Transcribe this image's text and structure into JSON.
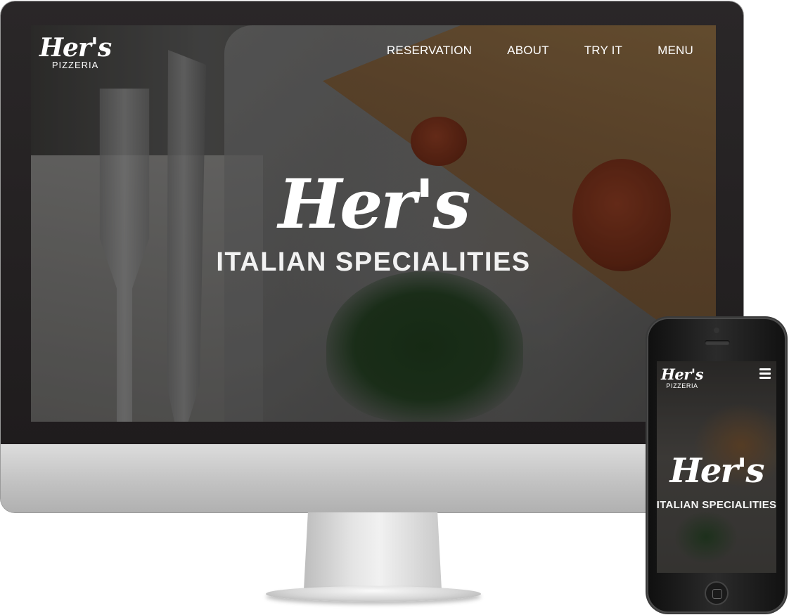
{
  "brand": {
    "name": "Her's",
    "tagline": "PIZZERIA"
  },
  "nav": {
    "items": [
      {
        "label": "RESERVATION"
      },
      {
        "label": "ABOUT"
      },
      {
        "label": "TRY IT"
      },
      {
        "label": "MENU"
      }
    ]
  },
  "hero": {
    "title": "Her's",
    "subtitle": "ITALIAN SPECIALITIES"
  },
  "mobile": {
    "brand_name": "Her's",
    "brand_tagline": "PIZZERIA",
    "menu_icon": "hamburger-icon",
    "hero_title": "Her's",
    "hero_subtitle": "ITALIAN SPECIALITIES"
  },
  "colors": {
    "text": "#ffffff",
    "device_bezel": "#231f20",
    "device_silver": "#c8c8c8"
  }
}
